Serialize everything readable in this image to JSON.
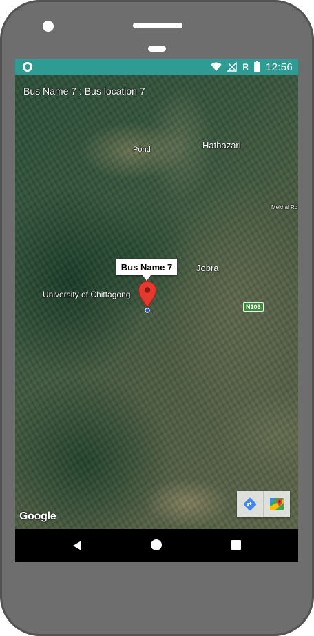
{
  "status_bar": {
    "time": "12:56",
    "roaming": "R",
    "icons": [
      "app-notification-icon",
      "wifi-icon",
      "cellular-signal-icon",
      "roaming-icon",
      "battery-charging-icon"
    ]
  },
  "map": {
    "overlay_title": "Bus Name 7 : Bus location 7",
    "places": {
      "pond": "Pond",
      "hathazari": "Hathazari",
      "mekhal_rd": "Mekhal Rd",
      "jobra": "Jobra",
      "university": "University of Chittagong"
    },
    "road_badge": "N106",
    "marker_title": "Bus Name 7",
    "attribution": "Google",
    "toolbar": [
      "directions-icon",
      "google-maps-icon"
    ],
    "marker_color": "#e5382f"
  },
  "nav_bar": {
    "buttons": [
      "back-icon",
      "home-icon",
      "recents-icon"
    ]
  }
}
